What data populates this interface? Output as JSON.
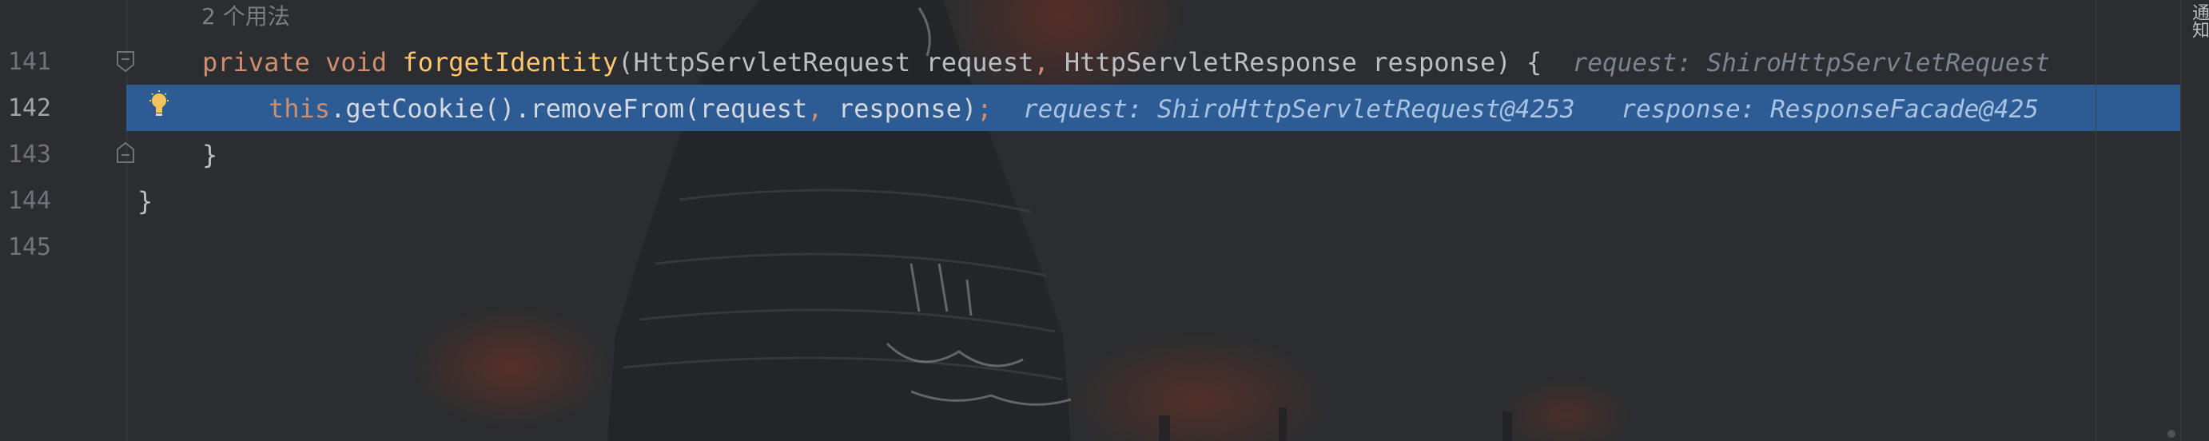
{
  "editor": {
    "usages_hint": "2 个用法",
    "lines": [
      {
        "number": "141"
      },
      {
        "number": "142"
      },
      {
        "number": "143"
      },
      {
        "number": "144"
      },
      {
        "number": "145"
      }
    ],
    "code": {
      "l141": {
        "kw_private": "private",
        "kw_void": "void",
        "method_name": "forgetIdentity",
        "open_paren": "(",
        "type1": "HttpServletRequest",
        "param1": "request",
        "comma1": ",",
        "type2": "HttpServletResponse",
        "param2": "response",
        "close": ") {",
        "inlay": "request: ShiroHttpServletRequest"
      },
      "l142": {
        "kw_this": "this",
        "call1": ".getCookie().removeFrom(",
        "arg1": "request",
        "comma": ",",
        "arg2": "response",
        "close": ")",
        "semicolon": ";",
        "inlay1": "request: ShiroHttpServletRequest@4253",
        "inlay2": "response: ResponseFacade@425"
      },
      "l143": {
        "text": "}"
      },
      "l144": {
        "text": "}"
      }
    }
  },
  "side_panel": {
    "notifications_label": "通知"
  },
  "colors": {
    "background": "#2b2d30",
    "execution_highlight": "#2d5c95",
    "keyword": "#cf8e6d",
    "method_declaration": "#ffc66d",
    "text": "#bcbec4"
  }
}
